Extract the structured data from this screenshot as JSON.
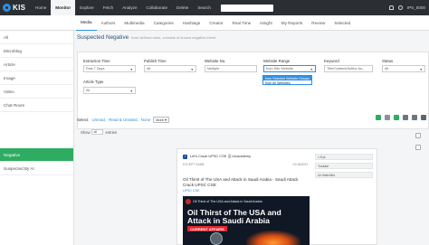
{
  "brand": {
    "name": "KIS"
  },
  "topnav": {
    "items": [
      "Home",
      "Monitor",
      "Explore",
      "Fetch",
      "Analyze",
      "Collaborate",
      "Delete",
      "Search"
    ],
    "user": "IPS_5000"
  },
  "subtabs": [
    "Media",
    "Authors",
    "Multimedia",
    "Categories",
    "Hashtags",
    "Creator",
    "Real Time",
    "Insight",
    "My Reports",
    "Review",
    "Selected"
  ],
  "sidebar": {
    "items": [
      "All",
      "Microblog",
      "Article",
      "Image",
      "Video",
      "Chat Room"
    ],
    "items2": [
      "Negative",
      "Suspected By AI"
    ]
  },
  "header": {
    "title": "Suspected Negative",
    "subtitle": "from defined rules, consists of known negative intent"
  },
  "filters": {
    "extraction_time": {
      "label": "Extraction Time",
      "value": "Past 7 Days"
    },
    "publish_time": {
      "label": "Publish Time",
      "value": "All"
    },
    "website_no": {
      "label": "Website No.",
      "placeholder": "Multiple"
    },
    "website_range": {
      "label": "Website Range",
      "value": "from Site Website",
      "options": [
        "from Selected Website Groups",
        "from All Websites"
      ]
    },
    "keyword": {
      "label": "Keyword",
      "placeholder": "Title/Content/Author Au..."
    },
    "status": {
      "label": "Status",
      "value": "All"
    },
    "article_type": {
      "label": "Article Type",
      "value": "All"
    }
  },
  "selection": {
    "select_label": "Select:",
    "unread": "Unread,",
    "read_unrated": "Read & Unrated,",
    "none": "None",
    "more": "More"
  },
  "show": {
    "prefix": "Show",
    "value": "all",
    "suffix": "entries"
  },
  "card": {
    "handle": "Let's Crack UPSC CSE 当 Unacademy",
    "source": "EXCEPT GAME",
    "date": "02/18/2023",
    "title": "Oil Thirst of The USA and Attack in Saudi Arabia - Saudi Attack Crack UPSC CSE",
    "link": "UPSC CSE",
    "meta": [
      "1.5 pt",
      "Youtube",
      "Un Watchlist"
    ],
    "video": {
      "caption": "Oil Thirst of The USA and Attack in Saudi Arabia",
      "headline": "Oil Thirst of The USA and Attack in Saudi Arabia",
      "strip": "CURRENT AFFAIRS"
    }
  },
  "colors": {
    "accent": "#2f8fe0",
    "active_side": "#2eac62",
    "topbar": "#2b2f33"
  }
}
